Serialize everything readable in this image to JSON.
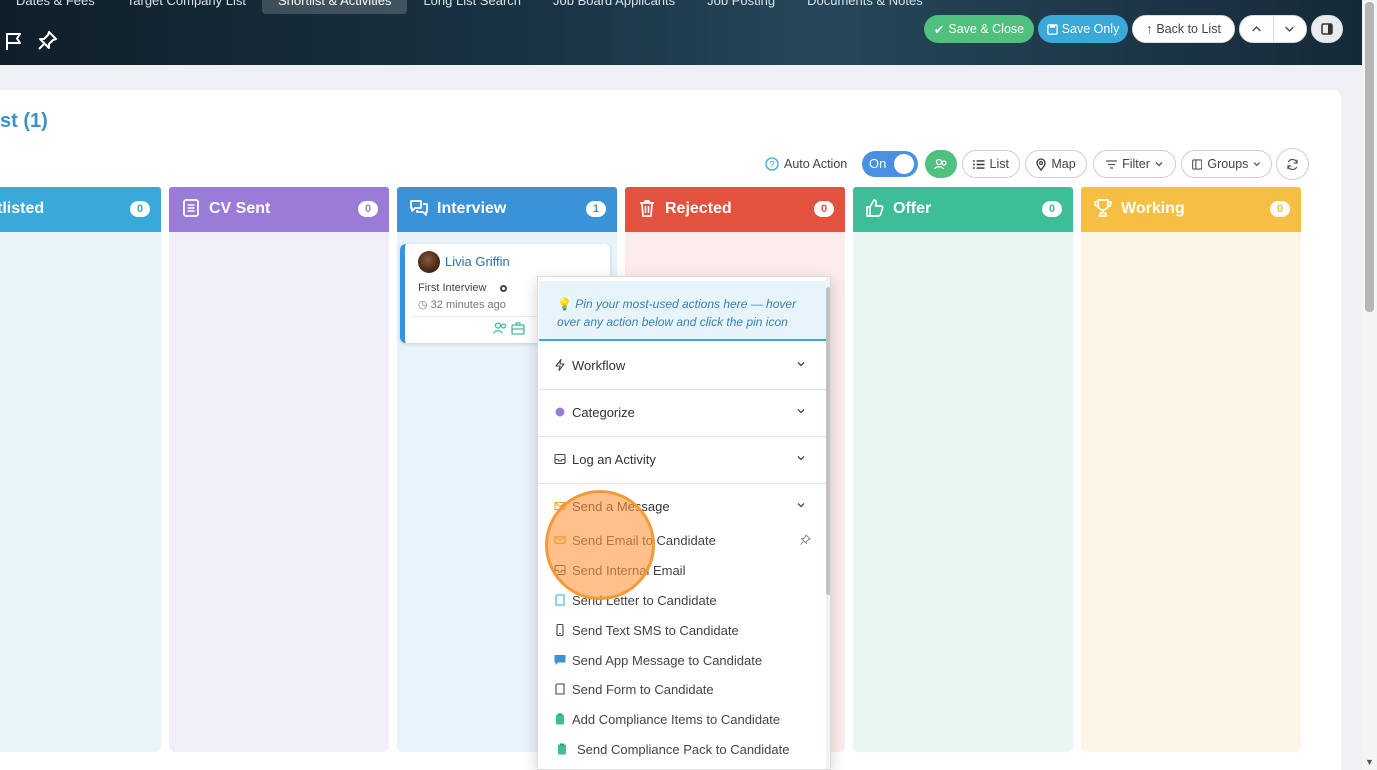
{
  "header": {
    "tabs": [
      "Dates & Fees",
      "Target Company List",
      "Shortlist & Activities",
      "Long List Search",
      "Job Board Applicants",
      "Job Posting",
      "Documents & Notes"
    ],
    "active_tab": "Shortlist & Activities",
    "buttons": {
      "save_close": "Save & Close",
      "save_only": "Save Only",
      "back_to_list": "Back to List"
    }
  },
  "page": {
    "title": "st (1)"
  },
  "toolbar": {
    "auto_action_label": "Auto Action",
    "toggle_label": "On",
    "list": "List",
    "map": "Map",
    "filter": "Filter",
    "groups": "Groups"
  },
  "columns": [
    {
      "title": "ortlisted",
      "count": "0",
      "color": "#3aa8d8",
      "bg": "#e9f5fb"
    },
    {
      "title": "CV Sent",
      "count": "0",
      "color": "#9b7bd8",
      "bg": "#f2eefa"
    },
    {
      "title": "Interview",
      "count": "1",
      "color": "#3a93d8",
      "bg": "#e9f3fb"
    },
    {
      "title": "Rejected",
      "count": "0",
      "color": "#e2523e",
      "bg": "#fceceb"
    },
    {
      "title": "Offer",
      "count": "0",
      "color": "#3dbd98",
      "bg": "#e8f7f2"
    },
    {
      "title": "Working",
      "count": "0",
      "color": "#f4bf42",
      "bg": "#fdf6e6"
    }
  ],
  "card": {
    "name": "Livia Griffin",
    "stage": "First Interview",
    "time_ago": "32 minutes ago"
  },
  "menu": {
    "tip": "Pin your most-used actions here — hover over any action below and click the pin icon",
    "sections": {
      "workflow": "Workflow",
      "categorize": "Categorize",
      "log_activity": "Log an Activity",
      "send_message": "Send a Message"
    },
    "items": [
      "Send Email to Candidate",
      "Send Internal Email",
      "Send Letter to Candidate",
      "Send Text SMS to Candidate",
      "Send App Message to Candidate",
      "Send Form to Candidate",
      "Add Compliance Items to Candidate",
      "Send Compliance Pack to Candidate"
    ]
  },
  "colors": {
    "accent": "#3aa8d8",
    "green": "#4fc07d"
  }
}
